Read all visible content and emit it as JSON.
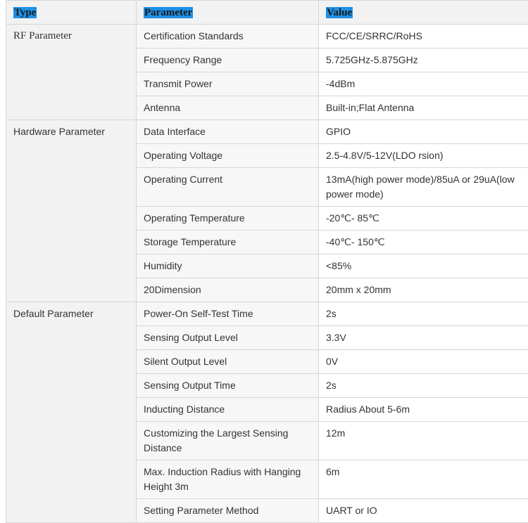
{
  "header": {
    "type": "Type",
    "parameter": "Parameter",
    "value": "Value"
  },
  "groups": [
    {
      "type": "RF Parameter",
      "rows": [
        {
          "parameter": "Certification Standards",
          "value": "FCC/CE/SRRC/RoHS"
        },
        {
          "parameter": "Frequency Range",
          "value": "5.725GHz-5.875GHz"
        },
        {
          "parameter": "Transmit Power",
          "value": "-4dBm"
        },
        {
          "parameter": "Antenna",
          "value": "Built-in;Flat Antenna"
        }
      ]
    },
    {
      "type": "Hardware Parameter",
      "rows": [
        {
          "parameter": "Data Interface",
          "value": "GPIO"
        },
        {
          "parameter": "Operating Voltage",
          "value": "2.5-4.8V/5-12V(LDO rsion)"
        },
        {
          "parameter": "Operating Current",
          "value": "13mA(high power mode)/85uA or 29uA(low power mode)"
        },
        {
          "parameter": "Operating Temperature",
          "value": "-20℃- 85℃"
        },
        {
          "parameter": "Storage Temperature",
          "value": "-40℃- 150℃"
        },
        {
          "parameter": "Humidity",
          "value": "<85%"
        },
        {
          "parameter": "20Dimension",
          "value": "20mm x 20mm"
        }
      ]
    },
    {
      "type": "Default Parameter",
      "rows": [
        {
          "parameter": "Power-On Self-Test Time",
          "value": "2s"
        },
        {
          "parameter": "Sensing Output Level",
          "value": "3.3V"
        },
        {
          "parameter": "Silent Output Level",
          "value": "0V"
        },
        {
          "parameter": "Sensing Output Time",
          "value": "2s"
        },
        {
          "parameter": "Inducting Distance",
          "value": "Radius About 5-6m"
        },
        {
          "parameter": "Customizing the Largest Sensing Distance",
          "value": "12m"
        },
        {
          "parameter": "Max. Induction Radius with Hanging Height 3m",
          "value": "6m"
        },
        {
          "parameter": "Setting Parameter Method",
          "value": "UART or IO"
        }
      ]
    }
  ],
  "colors": {
    "header_highlight": "#1e90e6",
    "border": "#d6d6d6",
    "header_bg": "#f2f2f2"
  }
}
